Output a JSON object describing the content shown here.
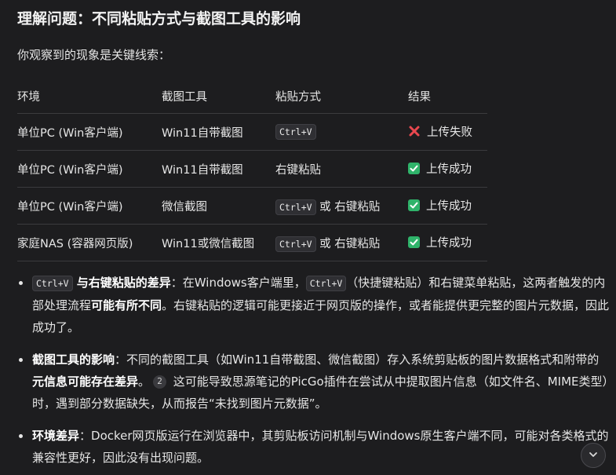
{
  "heading": "理解问题：不同粘贴方式与截图工具的影响",
  "intro": "你观察到的现象是关键线索：",
  "table": {
    "headers": [
      "环境",
      "截图工具",
      "粘贴方式",
      "结果"
    ],
    "rows": [
      {
        "env": "单位PC (Win客户端)",
        "tool": "Win11自带截图",
        "paste_code": "Ctrl+V",
        "paste_text": "",
        "status": "fail",
        "result": "上传失败"
      },
      {
        "env": "单位PC (Win客户端)",
        "tool": "Win11自带截图",
        "paste_code": "",
        "paste_text": "右键粘贴",
        "status": "success",
        "result": "上传成功"
      },
      {
        "env": "单位PC (Win客户端)",
        "tool": "微信截图",
        "paste_code": "Ctrl+V",
        "paste_text": " 或 右键粘贴",
        "status": "success",
        "result": "上传成功"
      },
      {
        "env": "家庭NAS (容器网页版)",
        "tool": "Win11或微信截图",
        "paste_code": "Ctrl+V",
        "paste_text": " 或 右键粘贴",
        "status": "success",
        "result": "上传成功"
      }
    ]
  },
  "bullets": [
    {
      "code": "Ctrl+V",
      "title": " 与右键粘贴的差异",
      "t1": "：在Windows客户端里，",
      "code2": "Ctrl+V",
      "t2": "（快捷键粘贴）和右键菜单粘贴，这两者触发的内部处理流程",
      "bold2": "可能有所不同",
      "t3": "。右键粘贴的逻辑可能更接近于网页版的操作，或者能提供更完整的图片元数据，因此成功了。"
    },
    {
      "title": "截图工具的影响",
      "t1": "：不同的截图工具（如Win11自带截图、微信截图）存入系统剪贴板的图片数据格式和附带的",
      "bold2": "元信息可能存在差异",
      "t2": "。",
      "ref": "2",
      "t3": " 这可能导致思源笔记的PicGo插件在尝试从中提取图片信息（如文件名、MIME类型）时，遇到部分数据缺失，从而报告“未找到图片元数据”。"
    },
    {
      "title": "环境差异",
      "t1": "：Docker网页版运行在浏览器中，其剪贴板访问机制与Windows原生客户端不同，可能对各类格式的兼容性更好，因此没有出现问题。"
    }
  ],
  "icons": {
    "fail": "cross-mark-icon",
    "success": "check-mark-icon",
    "scroll": "chevron-down-icon"
  },
  "colors": {
    "background": "#1d1d1f",
    "fail": "#e8484f",
    "success": "#2fb36a"
  }
}
